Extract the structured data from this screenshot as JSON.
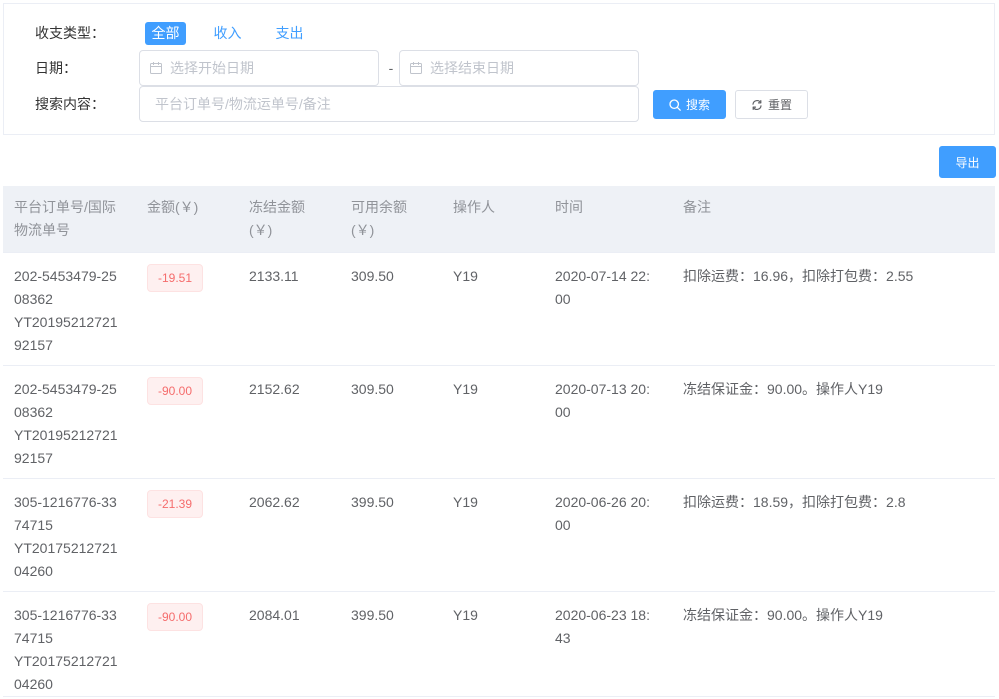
{
  "filters": {
    "type": {
      "label": "收支类型：",
      "options": [
        {
          "label": "全部",
          "selected": true
        },
        {
          "label": "收入",
          "selected": false
        },
        {
          "label": "支出",
          "selected": false
        }
      ]
    },
    "date": {
      "label": "日期：",
      "start_placeholder": "选择开始日期",
      "start_value": "",
      "separator": "-",
      "end_placeholder": "选择结束日期",
      "end_value": ""
    },
    "search": {
      "label": "搜索内容：",
      "placeholder": "平台订单号/物流运单号/备注",
      "value": "",
      "search_button": "搜索",
      "reset_button": "重置"
    }
  },
  "toolbar": {
    "export_button": "导出"
  },
  "table": {
    "columns": [
      "平台订单号/国际物流单号",
      "金额(￥)",
      "冻结金额(￥)",
      "可用余额(￥)",
      "操作人",
      "时间",
      "备注"
    ],
    "rows": [
      {
        "order_no": "202-5453479-2508362",
        "tracking_no": "YT2019521272192157",
        "amount": "-19.51",
        "frozen": "2133.11",
        "available": "309.50",
        "operator": "Y19",
        "time": "2020-07-14 22:00",
        "note": "扣除运费：16.96，扣除打包费：2.55"
      },
      {
        "order_no": "202-5453479-2508362",
        "tracking_no": "YT2019521272192157",
        "amount": "-90.00",
        "frozen": "2152.62",
        "available": "309.50",
        "operator": "Y19",
        "time": "2020-07-13 20:00",
        "note": "冻结保证金：90.00。操作人Y19"
      },
      {
        "order_no": "305-1216776-3374715",
        "tracking_no": "YT2017521272104260",
        "amount": "-21.39",
        "frozen": "2062.62",
        "available": "399.50",
        "operator": "Y19",
        "time": "2020-06-26 20:00",
        "note": "扣除运费：18.59，扣除打包费：2.8"
      },
      {
        "order_no": "305-1216776-3374715",
        "tracking_no": "YT2017521272104260",
        "amount": "-90.00",
        "frozen": "2084.01",
        "available": "399.50",
        "operator": "Y19",
        "time": "2020-06-23 18:43",
        "note": "冻结保证金：90.00。操作人Y19"
      }
    ]
  },
  "icons": {
    "date_picker": "calendar-icon",
    "search_button": "search-icon",
    "reset_button": "refresh-icon"
  },
  "colors": {
    "primary": "#409eff",
    "danger": "#f56c6c",
    "danger_bg": "#fef0f0",
    "danger_border": "#fde2e2",
    "header_bg": "#eef1f6",
    "border": "#ebeef5"
  }
}
